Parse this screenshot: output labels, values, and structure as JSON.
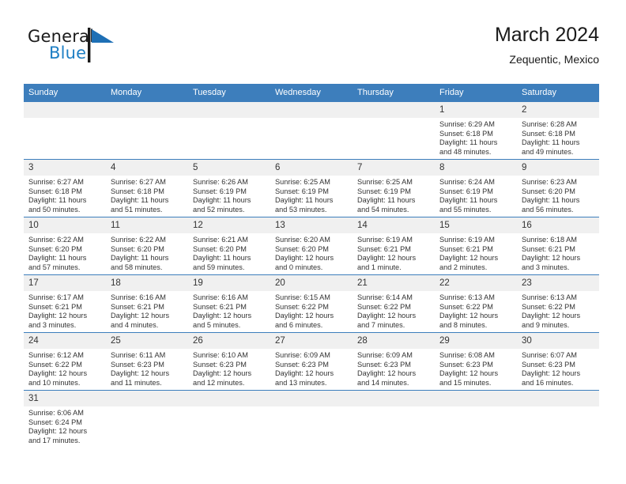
{
  "brand": {
    "name_top": "General",
    "name_bottom": "Blue",
    "mark": "triangle-flag-icon",
    "color_text": "#1a1a1a",
    "color_blue": "#1e7fc4"
  },
  "header": {
    "title": "March 2024",
    "subtitle": "Zequentic, Mexico"
  },
  "theme": {
    "header_bg": "#3d7ebc",
    "header_text": "#ffffff",
    "daynum_bg": "#f0f0f0",
    "cell_bg": "#ffffff",
    "row_border": "#3d7ebc"
  },
  "weekday_headers": [
    "Sunday",
    "Monday",
    "Tuesday",
    "Wednesday",
    "Thursday",
    "Friday",
    "Saturday"
  ],
  "weeks": [
    [
      {
        "day": "",
        "empty": true,
        "sunrise": "",
        "sunset": "",
        "daylight_line1": "",
        "daylight_line2": ""
      },
      {
        "day": "",
        "empty": true,
        "sunrise": "",
        "sunset": "",
        "daylight_line1": "",
        "daylight_line2": ""
      },
      {
        "day": "",
        "empty": true,
        "sunrise": "",
        "sunset": "",
        "daylight_line1": "",
        "daylight_line2": ""
      },
      {
        "day": "",
        "empty": true,
        "sunrise": "",
        "sunset": "",
        "daylight_line1": "",
        "daylight_line2": ""
      },
      {
        "day": "",
        "empty": true,
        "sunrise": "",
        "sunset": "",
        "daylight_line1": "",
        "daylight_line2": ""
      },
      {
        "day": "1",
        "empty": false,
        "sunrise": "Sunrise: 6:29 AM",
        "sunset": "Sunset: 6:18 PM",
        "daylight_line1": "Daylight: 11 hours",
        "daylight_line2": "and 48 minutes."
      },
      {
        "day": "2",
        "empty": false,
        "sunrise": "Sunrise: 6:28 AM",
        "sunset": "Sunset: 6:18 PM",
        "daylight_line1": "Daylight: 11 hours",
        "daylight_line2": "and 49 minutes."
      }
    ],
    [
      {
        "day": "3",
        "empty": false,
        "sunrise": "Sunrise: 6:27 AM",
        "sunset": "Sunset: 6:18 PM",
        "daylight_line1": "Daylight: 11 hours",
        "daylight_line2": "and 50 minutes."
      },
      {
        "day": "4",
        "empty": false,
        "sunrise": "Sunrise: 6:27 AM",
        "sunset": "Sunset: 6:18 PM",
        "daylight_line1": "Daylight: 11 hours",
        "daylight_line2": "and 51 minutes."
      },
      {
        "day": "5",
        "empty": false,
        "sunrise": "Sunrise: 6:26 AM",
        "sunset": "Sunset: 6:19 PM",
        "daylight_line1": "Daylight: 11 hours",
        "daylight_line2": "and 52 minutes."
      },
      {
        "day": "6",
        "empty": false,
        "sunrise": "Sunrise: 6:25 AM",
        "sunset": "Sunset: 6:19 PM",
        "daylight_line1": "Daylight: 11 hours",
        "daylight_line2": "and 53 minutes."
      },
      {
        "day": "7",
        "empty": false,
        "sunrise": "Sunrise: 6:25 AM",
        "sunset": "Sunset: 6:19 PM",
        "daylight_line1": "Daylight: 11 hours",
        "daylight_line2": "and 54 minutes."
      },
      {
        "day": "8",
        "empty": false,
        "sunrise": "Sunrise: 6:24 AM",
        "sunset": "Sunset: 6:19 PM",
        "daylight_line1": "Daylight: 11 hours",
        "daylight_line2": "and 55 minutes."
      },
      {
        "day": "9",
        "empty": false,
        "sunrise": "Sunrise: 6:23 AM",
        "sunset": "Sunset: 6:20 PM",
        "daylight_line1": "Daylight: 11 hours",
        "daylight_line2": "and 56 minutes."
      }
    ],
    [
      {
        "day": "10",
        "empty": false,
        "sunrise": "Sunrise: 6:22 AM",
        "sunset": "Sunset: 6:20 PM",
        "daylight_line1": "Daylight: 11 hours",
        "daylight_line2": "and 57 minutes."
      },
      {
        "day": "11",
        "empty": false,
        "sunrise": "Sunrise: 6:22 AM",
        "sunset": "Sunset: 6:20 PM",
        "daylight_line1": "Daylight: 11 hours",
        "daylight_line2": "and 58 minutes."
      },
      {
        "day": "12",
        "empty": false,
        "sunrise": "Sunrise: 6:21 AM",
        "sunset": "Sunset: 6:20 PM",
        "daylight_line1": "Daylight: 11 hours",
        "daylight_line2": "and 59 minutes."
      },
      {
        "day": "13",
        "empty": false,
        "sunrise": "Sunrise: 6:20 AM",
        "sunset": "Sunset: 6:20 PM",
        "daylight_line1": "Daylight: 12 hours",
        "daylight_line2": "and 0 minutes."
      },
      {
        "day": "14",
        "empty": false,
        "sunrise": "Sunrise: 6:19 AM",
        "sunset": "Sunset: 6:21 PM",
        "daylight_line1": "Daylight: 12 hours",
        "daylight_line2": "and 1 minute."
      },
      {
        "day": "15",
        "empty": false,
        "sunrise": "Sunrise: 6:19 AM",
        "sunset": "Sunset: 6:21 PM",
        "daylight_line1": "Daylight: 12 hours",
        "daylight_line2": "and 2 minutes."
      },
      {
        "day": "16",
        "empty": false,
        "sunrise": "Sunrise: 6:18 AM",
        "sunset": "Sunset: 6:21 PM",
        "daylight_line1": "Daylight: 12 hours",
        "daylight_line2": "and 3 minutes."
      }
    ],
    [
      {
        "day": "17",
        "empty": false,
        "sunrise": "Sunrise: 6:17 AM",
        "sunset": "Sunset: 6:21 PM",
        "daylight_line1": "Daylight: 12 hours",
        "daylight_line2": "and 3 minutes."
      },
      {
        "day": "18",
        "empty": false,
        "sunrise": "Sunrise: 6:16 AM",
        "sunset": "Sunset: 6:21 PM",
        "daylight_line1": "Daylight: 12 hours",
        "daylight_line2": "and 4 minutes."
      },
      {
        "day": "19",
        "empty": false,
        "sunrise": "Sunrise: 6:16 AM",
        "sunset": "Sunset: 6:21 PM",
        "daylight_line1": "Daylight: 12 hours",
        "daylight_line2": "and 5 minutes."
      },
      {
        "day": "20",
        "empty": false,
        "sunrise": "Sunrise: 6:15 AM",
        "sunset": "Sunset: 6:22 PM",
        "daylight_line1": "Daylight: 12 hours",
        "daylight_line2": "and 6 minutes."
      },
      {
        "day": "21",
        "empty": false,
        "sunrise": "Sunrise: 6:14 AM",
        "sunset": "Sunset: 6:22 PM",
        "daylight_line1": "Daylight: 12 hours",
        "daylight_line2": "and 7 minutes."
      },
      {
        "day": "22",
        "empty": false,
        "sunrise": "Sunrise: 6:13 AM",
        "sunset": "Sunset: 6:22 PM",
        "daylight_line1": "Daylight: 12 hours",
        "daylight_line2": "and 8 minutes."
      },
      {
        "day": "23",
        "empty": false,
        "sunrise": "Sunrise: 6:13 AM",
        "sunset": "Sunset: 6:22 PM",
        "daylight_line1": "Daylight: 12 hours",
        "daylight_line2": "and 9 minutes."
      }
    ],
    [
      {
        "day": "24",
        "empty": false,
        "sunrise": "Sunrise: 6:12 AM",
        "sunset": "Sunset: 6:22 PM",
        "daylight_line1": "Daylight: 12 hours",
        "daylight_line2": "and 10 minutes."
      },
      {
        "day": "25",
        "empty": false,
        "sunrise": "Sunrise: 6:11 AM",
        "sunset": "Sunset: 6:23 PM",
        "daylight_line1": "Daylight: 12 hours",
        "daylight_line2": "and 11 minutes."
      },
      {
        "day": "26",
        "empty": false,
        "sunrise": "Sunrise: 6:10 AM",
        "sunset": "Sunset: 6:23 PM",
        "daylight_line1": "Daylight: 12 hours",
        "daylight_line2": "and 12 minutes."
      },
      {
        "day": "27",
        "empty": false,
        "sunrise": "Sunrise: 6:09 AM",
        "sunset": "Sunset: 6:23 PM",
        "daylight_line1": "Daylight: 12 hours",
        "daylight_line2": "and 13 minutes."
      },
      {
        "day": "28",
        "empty": false,
        "sunrise": "Sunrise: 6:09 AM",
        "sunset": "Sunset: 6:23 PM",
        "daylight_line1": "Daylight: 12 hours",
        "daylight_line2": "and 14 minutes."
      },
      {
        "day": "29",
        "empty": false,
        "sunrise": "Sunrise: 6:08 AM",
        "sunset": "Sunset: 6:23 PM",
        "daylight_line1": "Daylight: 12 hours",
        "daylight_line2": "and 15 minutes."
      },
      {
        "day": "30",
        "empty": false,
        "sunrise": "Sunrise: 6:07 AM",
        "sunset": "Sunset: 6:23 PM",
        "daylight_line1": "Daylight: 12 hours",
        "daylight_line2": "and 16 minutes."
      }
    ],
    [
      {
        "day": "31",
        "empty": false,
        "sunrise": "Sunrise: 6:06 AM",
        "sunset": "Sunset: 6:24 PM",
        "daylight_line1": "Daylight: 12 hours",
        "daylight_line2": "and 17 minutes."
      },
      {
        "day": "",
        "empty": true,
        "sunrise": "",
        "sunset": "",
        "daylight_line1": "",
        "daylight_line2": ""
      },
      {
        "day": "",
        "empty": true,
        "sunrise": "",
        "sunset": "",
        "daylight_line1": "",
        "daylight_line2": ""
      },
      {
        "day": "",
        "empty": true,
        "sunrise": "",
        "sunset": "",
        "daylight_line1": "",
        "daylight_line2": ""
      },
      {
        "day": "",
        "empty": true,
        "sunrise": "",
        "sunset": "",
        "daylight_line1": "",
        "daylight_line2": ""
      },
      {
        "day": "",
        "empty": true,
        "sunrise": "",
        "sunset": "",
        "daylight_line1": "",
        "daylight_line2": ""
      },
      {
        "day": "",
        "empty": true,
        "sunrise": "",
        "sunset": "",
        "daylight_line1": "",
        "daylight_line2": ""
      }
    ]
  ]
}
